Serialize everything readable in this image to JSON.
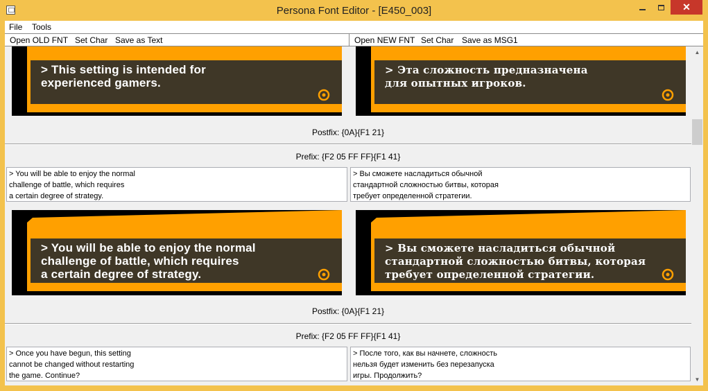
{
  "window": {
    "title": "Persona Font Editor - [E450_003]",
    "close_glyph": "✕"
  },
  "menu": {
    "file": "File",
    "tools": "Tools"
  },
  "toolbar_left": {
    "open": "Open OLD FNT",
    "set_char": "Set Char",
    "save": "Save as Text"
  },
  "toolbar_right": {
    "open": "Open NEW FNT",
    "set_char": "Set Char",
    "save": "Save as MSG1"
  },
  "scrollbar": {
    "up_glyph": "▲",
    "down_glyph": "▼"
  },
  "entries": [
    {
      "preview_old": "> This setting is intended for\nexperienced gamers.",
      "preview_new": "> Эта сложность предназначена\nдля опытных игроков.",
      "postfix": "Postfix: {0A}{F1 21}"
    },
    {
      "prefix": "Prefix: {F2 05 FF FF}{F1 41}",
      "text_old": "> You will be able to enjoy the normal\nchallenge of battle, which requires\na certain degree of strategy.",
      "text_new": "> Вы сможете насладиться обычной\nстандартной сложностью битвы, которая\nтребует определенной стратегии.",
      "preview_old": "> You will be able to enjoy the normal\nchallenge of battle, which requires\na certain degree of strategy.",
      "preview_new": "> Вы сможете насладиться обычной\nстандартной сложностью битвы, которая\nтребует определенной стратегии.",
      "postfix": "Postfix: {0A}{F1 21}"
    },
    {
      "prefix": "Prefix: {F2 05 FF FF}{F1 41}",
      "text_old": "> Once you have begun, this setting\ncannot be changed without restarting\nthe game. Continue?",
      "text_new": "> После того, как вы начнете, сложность\nнельзя будет изменить без перезапуска\nигры. Продолжить?"
    }
  ],
  "colors": {
    "accent": "#ffa000",
    "dialog_box": "#3f3727",
    "titlebar": "#f3c24d",
    "close": "#c7372a"
  }
}
